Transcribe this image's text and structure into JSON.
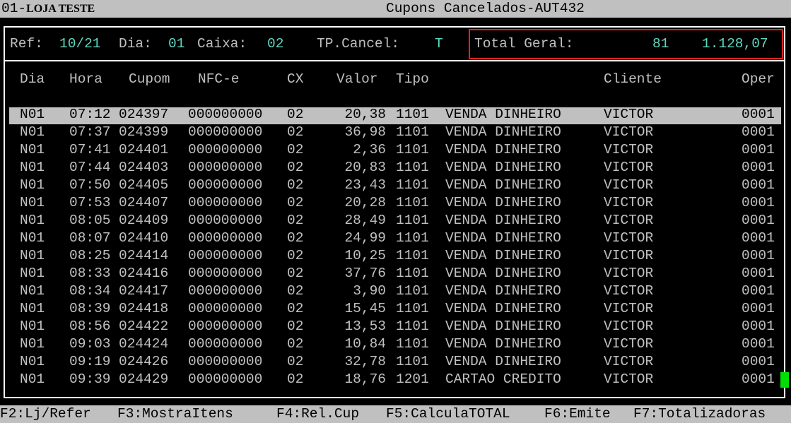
{
  "titlebar": {
    "store_code": "01-",
    "store_name": "LOJA TESTE",
    "title": "Cupons Cancelados-AUT432"
  },
  "filters": {
    "ref_label": "Ref:",
    "ref_value": "10/21",
    "dia_label": "Dia:",
    "dia_value": "01",
    "caixa_label": "Caixa:",
    "caixa_value": "02",
    "tpcancel_label": "TP.Cancel:",
    "tpcancel_value": "T",
    "total_label": "Total Geral:",
    "total_count": "81",
    "total_value": "1.128,07"
  },
  "columns": {
    "dia": "Dia",
    "hora": "Hora",
    "cupom": "Cupom",
    "nfce": "NFC-e",
    "cx": "CX",
    "valor": "Valor",
    "tipo": "Tipo",
    "cliente": "Cliente",
    "oper": "Oper"
  },
  "rows": [
    {
      "dia": "N01",
      "hora": "07:12",
      "cupom": "024397",
      "nfce": "000000000",
      "cx": "02",
      "valor": "20,38",
      "tipo": "1101",
      "desc": "VENDA DINHEIRO",
      "cliente": "VICTOR",
      "oper": "0001"
    },
    {
      "dia": "N01",
      "hora": "07:37",
      "cupom": "024399",
      "nfce": "000000000",
      "cx": "02",
      "valor": "36,98",
      "tipo": "1101",
      "desc": "VENDA DINHEIRO",
      "cliente": "VICTOR",
      "oper": "0001"
    },
    {
      "dia": "N01",
      "hora": "07:41",
      "cupom": "024401",
      "nfce": "000000000",
      "cx": "02",
      "valor": "2,36",
      "tipo": "1101",
      "desc": "VENDA DINHEIRO",
      "cliente": "VICTOR",
      "oper": "0001"
    },
    {
      "dia": "N01",
      "hora": "07:44",
      "cupom": "024403",
      "nfce": "000000000",
      "cx": "02",
      "valor": "20,83",
      "tipo": "1101",
      "desc": "VENDA DINHEIRO",
      "cliente": "VICTOR",
      "oper": "0001"
    },
    {
      "dia": "N01",
      "hora": "07:50",
      "cupom": "024405",
      "nfce": "000000000",
      "cx": "02",
      "valor": "23,43",
      "tipo": "1101",
      "desc": "VENDA DINHEIRO",
      "cliente": "VICTOR",
      "oper": "0001"
    },
    {
      "dia": "N01",
      "hora": "07:53",
      "cupom": "024407",
      "nfce": "000000000",
      "cx": "02",
      "valor": "20,28",
      "tipo": "1101",
      "desc": "VENDA DINHEIRO",
      "cliente": "VICTOR",
      "oper": "0001"
    },
    {
      "dia": "N01",
      "hora": "08:05",
      "cupom": "024409",
      "nfce": "000000000",
      "cx": "02",
      "valor": "28,49",
      "tipo": "1101",
      "desc": "VENDA DINHEIRO",
      "cliente": "VICTOR",
      "oper": "0001"
    },
    {
      "dia": "N01",
      "hora": "08:07",
      "cupom": "024410",
      "nfce": "000000000",
      "cx": "02",
      "valor": "24,99",
      "tipo": "1101",
      "desc": "VENDA DINHEIRO",
      "cliente": "VICTOR",
      "oper": "0001"
    },
    {
      "dia": "N01",
      "hora": "08:25",
      "cupom": "024414",
      "nfce": "000000000",
      "cx": "02",
      "valor": "10,25",
      "tipo": "1101",
      "desc": "VENDA DINHEIRO",
      "cliente": "VICTOR",
      "oper": "0001"
    },
    {
      "dia": "N01",
      "hora": "08:33",
      "cupom": "024416",
      "nfce": "000000000",
      "cx": "02",
      "valor": "37,76",
      "tipo": "1101",
      "desc": "VENDA DINHEIRO",
      "cliente": "VICTOR",
      "oper": "0001"
    },
    {
      "dia": "N01",
      "hora": "08:34",
      "cupom": "024417",
      "nfce": "000000000",
      "cx": "02",
      "valor": "3,90",
      "tipo": "1101",
      "desc": "VENDA DINHEIRO",
      "cliente": "VICTOR",
      "oper": "0001"
    },
    {
      "dia": "N01",
      "hora": "08:39",
      "cupom": "024418",
      "nfce": "000000000",
      "cx": "02",
      "valor": "15,45",
      "tipo": "1101",
      "desc": "VENDA DINHEIRO",
      "cliente": "VICTOR",
      "oper": "0001"
    },
    {
      "dia": "N01",
      "hora": "08:56",
      "cupom": "024422",
      "nfce": "000000000",
      "cx": "02",
      "valor": "13,53",
      "tipo": "1101",
      "desc": "VENDA DINHEIRO",
      "cliente": "VICTOR",
      "oper": "0001"
    },
    {
      "dia": "N01",
      "hora": "09:03",
      "cupom": "024424",
      "nfce": "000000000",
      "cx": "02",
      "valor": "10,84",
      "tipo": "1101",
      "desc": "VENDA DINHEIRO",
      "cliente": "VICTOR",
      "oper": "0001"
    },
    {
      "dia": "N01",
      "hora": "09:19",
      "cupom": "024426",
      "nfce": "000000000",
      "cx": "02",
      "valor": "32,78",
      "tipo": "1101",
      "desc": "VENDA DINHEIRO",
      "cliente": "VICTOR",
      "oper": "0001"
    },
    {
      "dia": "N01",
      "hora": "09:39",
      "cupom": "024429",
      "nfce": "000000000",
      "cx": "02",
      "valor": "18,76",
      "tipo": "1201",
      "desc": "CARTAO CREDITO",
      "cliente": "VICTOR",
      "oper": "0001"
    }
  ],
  "fkeys": [
    "F2:Lj/Refer",
    "F3:MostraItens",
    "F4:Rel.Cup",
    "F5:CalculaTOTAL",
    "F6:Emite",
    "F7:Totalizadoras"
  ],
  "colors": {
    "background": "#000000",
    "text": "#c0c0c0",
    "value": "#5fd7c0",
    "highlight_box": "#e02020",
    "cursor": "#00e000"
  }
}
